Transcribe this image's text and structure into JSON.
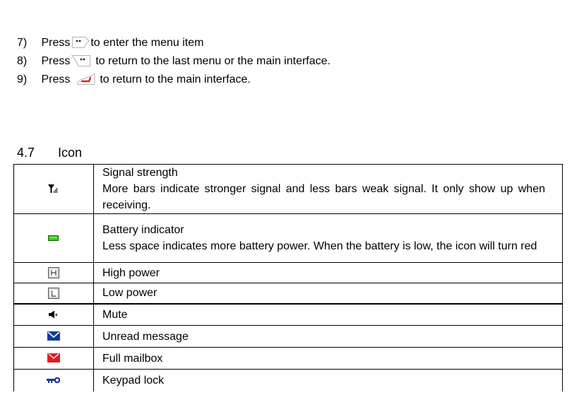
{
  "steps": [
    {
      "number": "7)",
      "press": "Press",
      "key_icon": "left-soft-key-icon",
      "text": "to enter the menu item"
    },
    {
      "number": "8)",
      "press": "Press",
      "key_icon": "right-soft-key-icon",
      "text": "to return to the last menu or the main interface."
    },
    {
      "number": "9)",
      "press": "Press",
      "key_icon": "end-call-key-icon",
      "text": "to return to the main interface."
    }
  ],
  "section": {
    "number": "4.7",
    "title": "Icon"
  },
  "icon_table": {
    "rows": [
      {
        "icon": "signal-strength-icon",
        "title": "Signal strength",
        "body": "More bars indicate stronger signal and less bars weak signal. It only show up when receiving."
      },
      {
        "icon": "battery-icon",
        "title": "Battery indicator",
        "body": "Less space indicates more battery power. When the battery is low, the icon will turn red"
      },
      {
        "icon": "high-power-icon",
        "title": "High power",
        "body": ""
      },
      {
        "icon": "low-power-icon",
        "title": "Low power",
        "body": ""
      },
      {
        "icon": "mute-icon",
        "title": "Mute",
        "body": ""
      },
      {
        "icon": "unread-message-icon",
        "title": "Unread message",
        "body": ""
      },
      {
        "icon": "full-mailbox-icon",
        "title": "Full mailbox",
        "body": ""
      },
      {
        "icon": "keypad-lock-icon",
        "title": "Keypad lock",
        "body": ""
      }
    ]
  },
  "colors": {
    "battery_green": "#3cc81e",
    "message_blue": "#0a3ca0",
    "mailbox_red": "#dc1e28",
    "keypad_blue": "#1432a0",
    "end_key_red": "#e61e1e"
  }
}
